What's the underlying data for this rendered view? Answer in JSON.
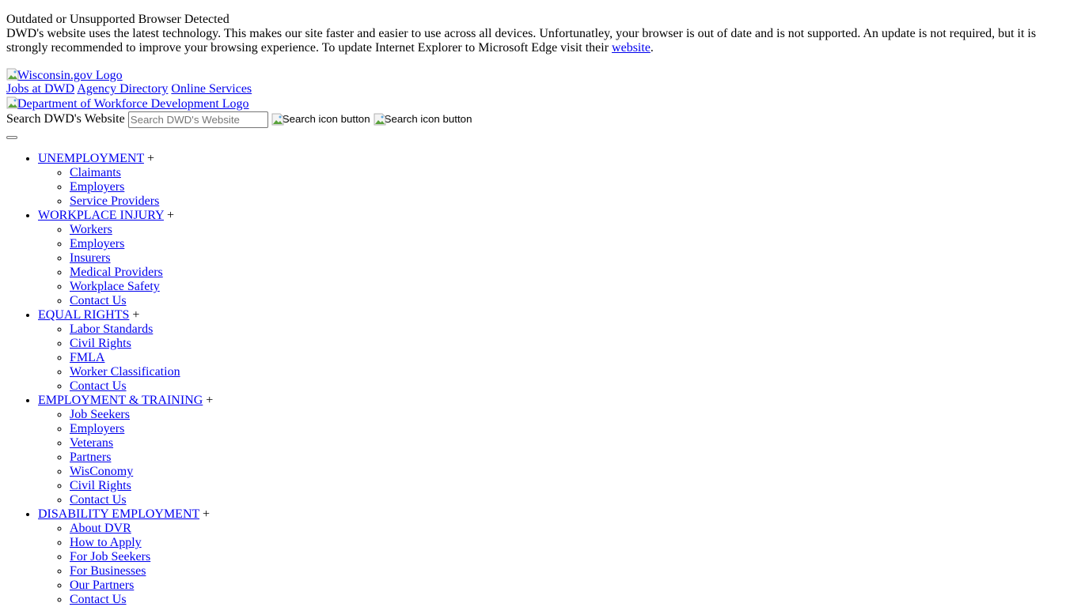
{
  "browser_notice": {
    "title": "Outdated or Unsupported Browser Detected",
    "text": "DWD's website uses the latest technology. This makes our site faster and easier to use across all devices. Unfortunatley, your browser is out of date and is not supported. An update is not required, but it is strongly recommended to improve your browsing experience. To update Internet Explorer to Microsoft Edge visit their ",
    "link_label": "website",
    "end": "."
  },
  "header": {
    "wisconsin_logo_alt": "Wisconsin.gov Logo",
    "utility_links": [
      "Jobs at DWD",
      "Agency Directory",
      "Online Services"
    ],
    "dwd_logo_alt": "Department of Workforce Development Logo",
    "search": {
      "label": "Search DWD's Website",
      "placeholder": "Search DWD's Website",
      "value": "",
      "button1_alt": "Search icon button",
      "button2_alt": "Search icon button"
    },
    "menu_toggle_label": ""
  },
  "nav": {
    "expand_symbol": "+",
    "sections": [
      {
        "label": "UNEMPLOYMENT",
        "items": [
          "Claimants",
          "Employers",
          "Service Providers"
        ]
      },
      {
        "label": "WORKPLACE INJURY",
        "items": [
          "Workers",
          "Employers",
          "Insurers",
          "Medical Providers",
          "Workplace Safety",
          "Contact Us"
        ]
      },
      {
        "label": "EQUAL RIGHTS",
        "items": [
          "Labor Standards",
          "Civil Rights",
          "FMLA",
          "Worker Classification",
          "Contact Us"
        ]
      },
      {
        "label": "EMPLOYMENT & TRAINING",
        "items": [
          "Job Seekers",
          "Employers",
          "Veterans",
          "Partners",
          "WisConomy",
          "Civil Rights",
          "Contact Us"
        ]
      },
      {
        "label": "DISABILITY EMPLOYMENT",
        "items": [
          "About DVR",
          "How to Apply",
          "For Job Seekers",
          "For Businesses",
          "Our Partners",
          "Contact Us"
        ]
      }
    ]
  },
  "colors": {
    "link": "#0000ee",
    "text": "#000000",
    "background": "#ffffff"
  }
}
